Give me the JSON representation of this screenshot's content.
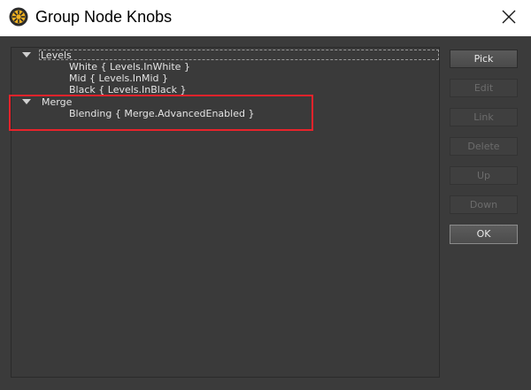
{
  "window": {
    "title": "Group Node Knobs",
    "app_icon": "app-logo-icon",
    "close_icon": "close-icon"
  },
  "tree": {
    "groups": [
      {
        "label": "Levels",
        "expanded": true,
        "children": [
          "White { Levels.InWhite }",
          "Mid { Levels.InMid }",
          "Black { Levels.InBlack }"
        ]
      },
      {
        "label": "Merge",
        "expanded": true,
        "children": [
          "Blending { Merge.AdvancedEnabled }"
        ]
      }
    ]
  },
  "buttons": {
    "pick": "Pick",
    "edit": "Edit",
    "link": "Link",
    "delete": "Delete",
    "up": "Up",
    "down": "Down",
    "ok": "OK"
  },
  "colors": {
    "background": "#3b3b3b",
    "highlight": "#e8232b",
    "text": "#e4e4e4",
    "disabled_text": "#6c6c6c"
  }
}
